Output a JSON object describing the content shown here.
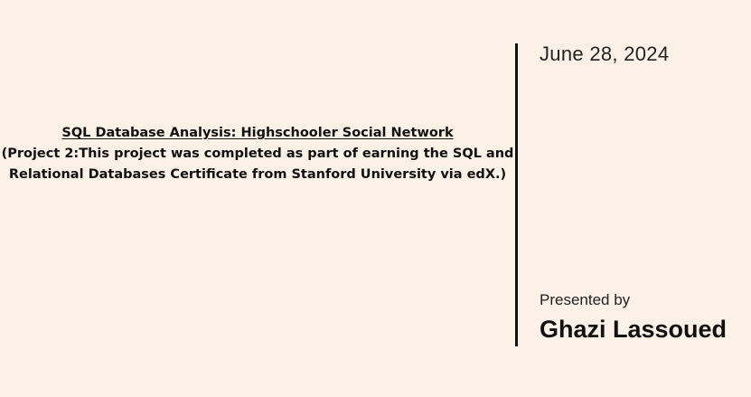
{
  "project": {
    "title": "SQL Database Analysis: Highschooler Social Network",
    "subtitle_line1": "(Project 2:This project was completed as part of earning the SQL and",
    "subtitle_line2": "Relational Databases Certificate from Stanford University via edX.)"
  },
  "meta": {
    "date": "June 28, 2024",
    "presented_by_label": "Presented by",
    "presenter_name": "Ghazi Lassoued"
  },
  "colors": {
    "background": "#fcf1e7",
    "text": "#111111",
    "divider": "#111111"
  }
}
